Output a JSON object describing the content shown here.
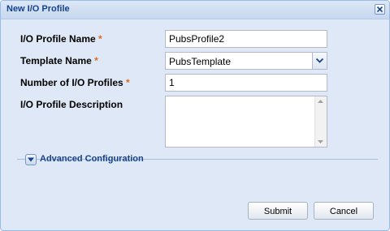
{
  "dialog": {
    "title": "New I/O Profile",
    "close_icon": "close-icon"
  },
  "form": {
    "profile_name": {
      "label": "I/O Profile Name",
      "required_marker": "*",
      "value": "PubsProfile2"
    },
    "template_name": {
      "label": "Template Name",
      "required_marker": "*",
      "value": "PubsTemplate"
    },
    "profile_count": {
      "label": "Number of I/O Profiles",
      "required_marker": "*",
      "value": "1"
    },
    "description": {
      "label": "I/O Profile Description",
      "value": ""
    }
  },
  "advanced": {
    "label": "Advanced Configuration",
    "expanded": false
  },
  "buttons": {
    "submit": "Submit",
    "cancel": "Cancel"
  },
  "colors": {
    "title": "#15428b",
    "required": "#e06a1b",
    "panel": "#dfe8f6"
  }
}
